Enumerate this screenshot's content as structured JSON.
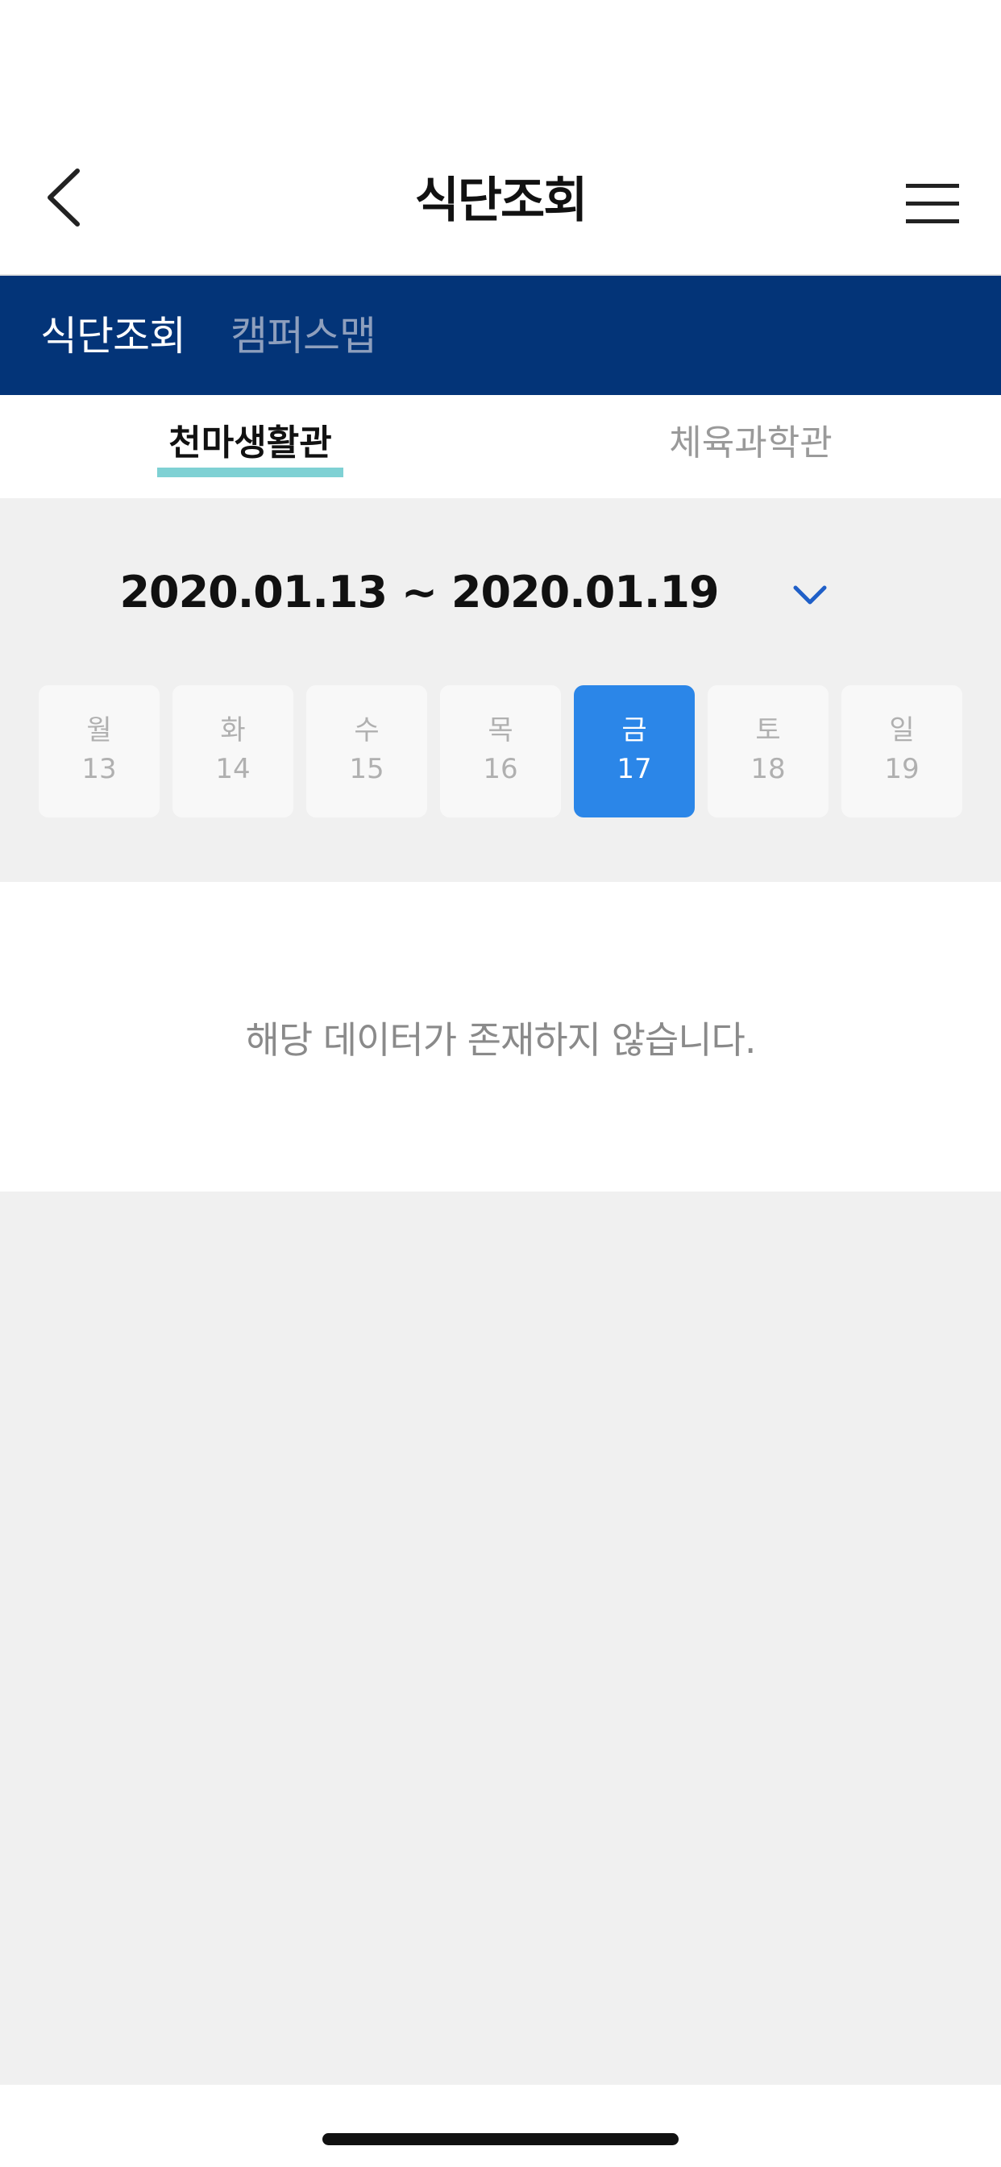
{
  "header": {
    "title": "식단조회",
    "back_icon": "chevron-left-icon",
    "menu_icon": "hamburger-menu-icon"
  },
  "topnav": {
    "items": [
      {
        "label": "식단조회",
        "active": true
      },
      {
        "label": "캠퍼스맵",
        "active": false
      }
    ],
    "background": "#033478"
  },
  "subtabs": [
    {
      "label": "천마생활관",
      "active": true
    },
    {
      "label": "체육과학관",
      "active": false
    }
  ],
  "date_range": {
    "label": "2020.01.13 ~ 2020.01.19",
    "toggle_icon": "chevron-down-icon"
  },
  "days": [
    {
      "name": "월",
      "date": "13"
    },
    {
      "name": "화",
      "date": "14"
    },
    {
      "name": "수",
      "date": "15"
    },
    {
      "name": "목",
      "date": "16"
    },
    {
      "name": "금",
      "date": "17",
      "selected": true
    },
    {
      "name": "토",
      "date": "18"
    },
    {
      "name": "일",
      "date": "19"
    }
  ],
  "content": {
    "empty_message": "해당 데이터가 존재하지 않습니다."
  },
  "colors": {
    "accent": "#2b86e8",
    "tab_underline": "#7fd1d4"
  }
}
